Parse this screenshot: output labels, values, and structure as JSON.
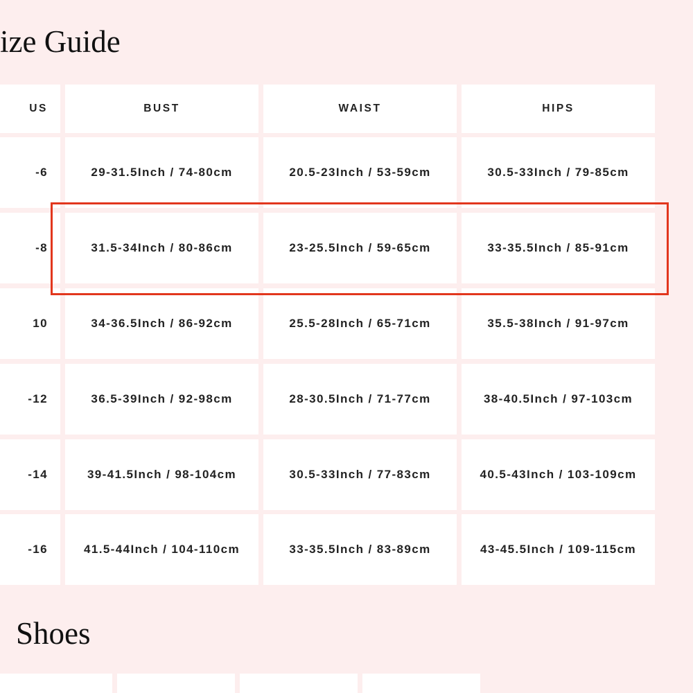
{
  "page": {
    "title": "ize Guide",
    "shoes_title": "Shoes"
  },
  "size_table": {
    "headers": {
      "size": "US",
      "bust": "BUST",
      "waist": "WAIST",
      "hips": "HIPS"
    },
    "rows": [
      {
        "size": "-6",
        "bust": "29-31.5Inch / 74-80cm",
        "waist": "20.5-23Inch / 53-59cm",
        "hips": "30.5-33Inch / 79-85cm"
      },
      {
        "size": "-8",
        "bust": "31.5-34Inch / 80-86cm",
        "waist": "23-25.5Inch / 59-65cm",
        "hips": "33-35.5Inch / 85-91cm"
      },
      {
        "size": "10",
        "bust": "34-36.5Inch / 86-92cm",
        "waist": "25.5-28Inch / 65-71cm",
        "hips": "35.5-38Inch / 91-97cm"
      },
      {
        "size": "-12",
        "bust": "36.5-39Inch / 92-98cm",
        "waist": "28-30.5Inch / 71-77cm",
        "hips": "38-40.5Inch / 97-103cm"
      },
      {
        "size": "-14",
        "bust": "39-41.5Inch / 98-104cm",
        "waist": "30.5-33Inch / 77-83cm",
        "hips": "40.5-43Inch / 103-109cm"
      },
      {
        "size": "-16",
        "bust": "41.5-44Inch / 104-110cm",
        "waist": "33-35.5Inch / 83-89cm",
        "hips": "43-45.5Inch / 109-115cm"
      }
    ],
    "highlighted_row": 1
  },
  "colors": {
    "page_background": "#fdeeee",
    "cell_background": "#ffffff",
    "highlight_border": "#e2361d",
    "text": "#222222"
  }
}
